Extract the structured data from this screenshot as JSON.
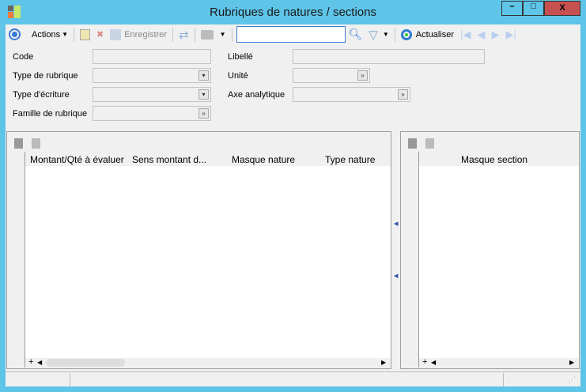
{
  "window": {
    "title": "Rubriques de natures / sections",
    "minimize": "–",
    "maximize": "□",
    "close": "X"
  },
  "toolbar": {
    "actions": "Actions",
    "save": "Enregistrer",
    "search_value": "",
    "refresh": "Actualiser"
  },
  "form": {
    "left": [
      {
        "label": "Code",
        "value": ""
      },
      {
        "label": "Type de rubrique",
        "value": ""
      },
      {
        "label": "Type d'écriture",
        "value": ""
      },
      {
        "label": "Famille de rubrique",
        "value": ""
      }
    ],
    "right": [
      {
        "label": "Libellé",
        "value": ""
      },
      {
        "label": "Unité",
        "value": ""
      },
      {
        "label": "Axe analytique",
        "value": ""
      }
    ]
  },
  "left_grid": {
    "columns": [
      "Montant/Qté à évaluer",
      "Sens montant d...",
      "Masque nature",
      "Type nature"
    ],
    "add": "+"
  },
  "right_grid": {
    "columns": [
      "Masque section"
    ],
    "add": "+"
  },
  "colors": {
    "frame": "#5ec5e8",
    "close": "#c75050"
  }
}
